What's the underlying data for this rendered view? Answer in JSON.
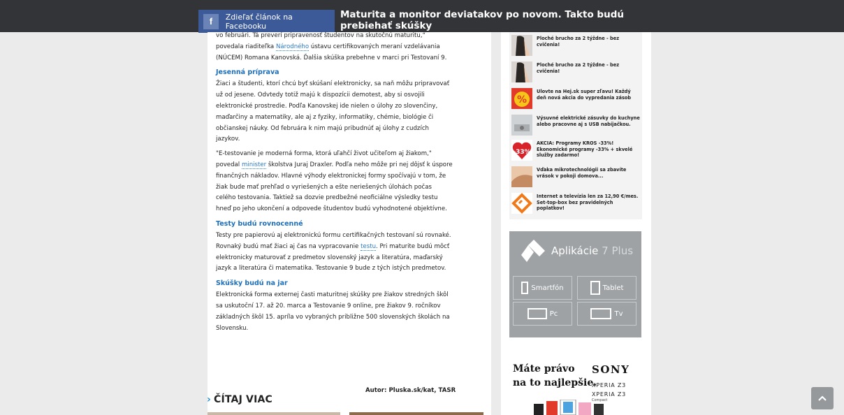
{
  "topbar": {
    "facebook_share_label": "Zdieľať článok na Facebooku",
    "facebook_icon_glyph": "f",
    "article_title": "Maturita a monitor deviatakov po novom. Takto budú prebiehať skúšky"
  },
  "article": {
    "p_intro": "vo februári. Tá preverí pripravenosť študentov na skutočnú maturitu,“ povedala riaditeľka Národného ústavu certifikovaných meraní vzdelávania (NÚCEM) Romana Kanovská. Ďalšia skúška prebehne v marci pri Testovaní 9.",
    "p_intro_a": "vo februári. Tá preverí pripravenosť študentov na skutočnú maturitu,“ povedala riaditeľka ",
    "p_intro_link": "Národného",
    "p_intro_b": " ústavu certifikovaných meraní vzdelávania (NÚCEM) Romana Kanovská. Ďalšia skúška prebehne v marci pri Testovaní 9.",
    "h_autumn": "Jesenná príprava",
    "p_autumn": "Žiaci a študenti, ktorí chcú byť skúšaní elektronicky, sa naň môžu pripravovať už od jesene. Odvtedy totiž majú k dispozícii demotest, aby si osvojili elektronické prostredie. Podľa Kanovskej ide nielen o úlohy zo slovenčiny, maďarčiny a matematiky, ale aj z fyziky, informatiky, chémie, biológie či občianskej náuky. Od februára k nim majú pribudnúť aj úlohy z cudzích jazykov.",
    "p_quote_a": "\"E-testovanie je moderná forma, ktorá uľahčí život učiteľom aj žiakom,\" povedal ",
    "p_quote_link": "minister",
    "p_quote_b": " školstva Juraj Draxler. Podľa neho môže pri nej dôjsť k úspore finančných nákladov. Hlavné výhody elektronickej formy spočívajú v tom, že žiak bude mať prehľad o vyriešených a ešte neriešených úlohách počas celého testovania. Taktiež sa dozvie predbežné neoficiálne výsledky testu hneď po jeho ukončení a odpovede študentov budú vyhodnotené objektívne.",
    "h_equal": "Testy budú rovnocenné",
    "p_equal_a": "Testy pre papierovú aj elektronickú formu certifikačných testovaní sú rovnaké. Rovnaký budú mať žiaci aj čas na vypracovanie ",
    "p_equal_link": "testu",
    "p_equal_b": ". Pri maturite budú môcť elektronicky maturovať z predmetov slovenský jazyk a literatúra, maďarský jazyk a literatúra či matematika. Testovanie 9 bude z tých istých predmetov.",
    "h_spring": "Skúšky budú na jar",
    "p_spring": "Elektronická forma externej časti maturitnej skúšky pre žiakov stredných škôl sa uskutoční 17. až 20. marca a Testovanie 9 online, pre žiakov 9. ročníkov základných škôl 15. apríla vo vybraných približne 500 slovenských školách na Slovensku.",
    "author": "Autor: Pluska.sk/kat, TASR",
    "read_more": "ČÍTAJ VIAC",
    "read_more_chevron": "›"
  },
  "sidebar": {
    "ads": [
      {
        "text": "Ploché brucho za 2 týždne - bez cvičenia!",
        "icon": "fitness-photo"
      },
      {
        "text": "Ploché brucho za 2 týždne - bez cvičenia!",
        "icon": "fitness-photo"
      },
      {
        "text": "Ulovte na Hej.sk super zľavu! Každý deň nová akcia do vypredania zásob",
        "icon": "percent-badge",
        "glyph": "%"
      },
      {
        "text": "Výsuvné elektrické zásuvky do kuchyne alebo pracovne aj s USB nabíjačkou.",
        "icon": "socket-photo"
      },
      {
        "text": "AKCIA: Programy KROS -33%! Ekonomické programy -33% + skvelé služby zadarmo!",
        "icon": "discount-badge",
        "glyph": "-33%"
      },
      {
        "text": "Vďaka mikrotechnológii sa zbavíte vrások v pokoji domova...",
        "icon": "face-photo"
      },
      {
        "text": "Internet a televízia len za 12,90 €/mes. Set-top-box bez pravidelných poplatkov!",
        "icon": "provider-logo"
      }
    ],
    "apps": {
      "title_main": "Aplikácie",
      "title_light": "7 Plus",
      "buttons": [
        "Smartfón",
        "Tablet",
        "Pc",
        "Tv"
      ]
    },
    "sony": {
      "claim_line1": "Máte právo",
      "claim_line2": "na to najlepšie.",
      "brand": "SONY",
      "model1": "XPERIA Z3",
      "model2": "XPERIA Z3",
      "compact": "Compact"
    }
  },
  "colors": {
    "topbar": "#323437",
    "facebook": "#3d5a98",
    "link": "#2a7bc9",
    "heading": "#1d6fb8",
    "apps_panel": "#9ea2a5"
  }
}
